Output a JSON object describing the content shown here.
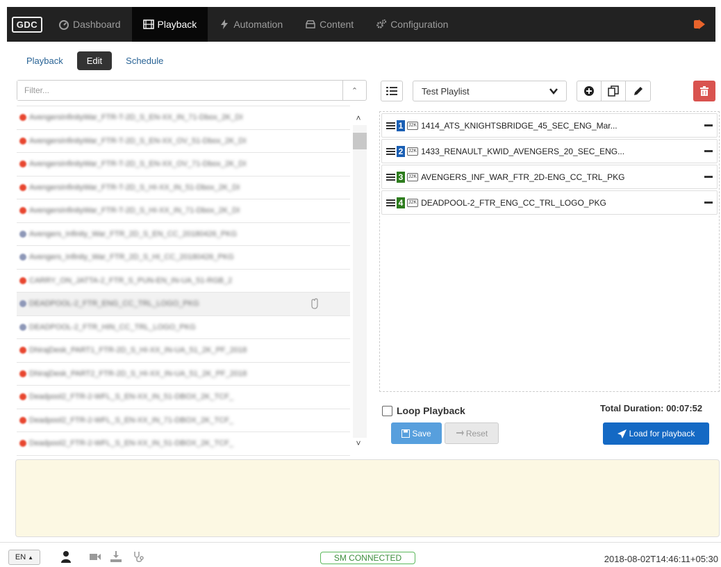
{
  "nav": {
    "logo": "GDC",
    "items": [
      {
        "label": "Dashboard",
        "icon": "dashboard-icon",
        "active": false
      },
      {
        "label": "Playback",
        "icon": "film-icon",
        "active": true
      },
      {
        "label": "Automation",
        "icon": "bolt-icon",
        "active": false
      },
      {
        "label": "Content",
        "icon": "content-icon",
        "active": false
      },
      {
        "label": "Configuration",
        "icon": "gears-icon",
        "active": false
      }
    ],
    "logout_icon": "logout-icon"
  },
  "subnav": {
    "items": [
      {
        "label": "Playback",
        "active": false
      },
      {
        "label": "Edit",
        "active": true
      },
      {
        "label": "Schedule",
        "active": false
      }
    ]
  },
  "filter": {
    "placeholder": "Filter...",
    "value": ""
  },
  "content_list": {
    "rows": [
      {
        "dot": "red",
        "text": "AvengersInfinityWar_FTR-T-2D_S_EN-XX_IN_71-Dbox_2K_DI"
      },
      {
        "dot": "red",
        "text": "AvengersInfinityWar_FTR-T-2D_S_EN-XX_OV_51-Dbox_2K_DI"
      },
      {
        "dot": "red",
        "text": "AvengersInfinityWar_FTR-T-2D_S_EN-XX_OV_71-Dbox_2K_DI"
      },
      {
        "dot": "red",
        "text": "AvengersInfinityWar_FTR-T-2D_S_HI-XX_IN_51-Dbox_2K_DI"
      },
      {
        "dot": "red",
        "text": "AvengersInfinityWar_FTR-T-2D_S_HI-XX_IN_71-Dbox_2K_DI"
      },
      {
        "dot": "blue",
        "text": "Avengers_Infinity_War_FTR_2D_S_EN_CC_20180426_PKG"
      },
      {
        "dot": "blue",
        "text": "Avengers_Infinity_War_FTR_2D_S_HI_CC_20180426_PKG"
      },
      {
        "dot": "red",
        "text": "CARRY_ON_JATTA-2_FTR_S_PUN-EN_IN-UA_51-RGB_2"
      },
      {
        "dot": "blue",
        "text": "DEADPOOL-2_FTR_ENG_CC_TRL_LOGO_PKG"
      },
      {
        "dot": "blue",
        "text": "DEADPOOL-2_FTR_HIN_CC_TRL_LOGO_PKG"
      },
      {
        "dot": "red",
        "text": "DhirajDesk_PART1_FTR-2D_S_HI-XX_IN-UA_51_2K_PF_2018"
      },
      {
        "dot": "red",
        "text": "DhirajDesk_PART2_FTR-2D_S_HI-XX_IN-UA_51_2K_PF_2018"
      },
      {
        "dot": "red",
        "text": "Deadpool2_FTR-2-WFL_S_EN-XX_IN_51-DBOX_2K_TCF_"
      },
      {
        "dot": "red",
        "text": "Deadpool2_FTR-2-WFL_S_EN-XX_IN_71-DBOX_2K_TCF_"
      },
      {
        "dot": "red",
        "text": "Deadpool2_FTR-2-WFL_S_EN-XX_IN_51-DBOX_2K_TCF_"
      }
    ]
  },
  "playlist": {
    "selected": "Test Playlist",
    "items": [
      {
        "number": "1",
        "color": "#1a5fb4",
        "format": "J2K",
        "name": "1414_ATS_KNIGHTSBRIDGE_45_SEC_ENG_Mar..."
      },
      {
        "number": "2",
        "color": "#1a5fb4",
        "format": "J2K",
        "name": "1433_RENAULT_KWID_AVENGERS_20_SEC_ENG..."
      },
      {
        "number": "3",
        "color": "#2e7d1e",
        "format": "J2K",
        "name": "AVENGERS_INF_WAR_FTR_2D-ENG_CC_TRL_PKG"
      },
      {
        "number": "4",
        "color": "#2e7d1e",
        "format": "J2K",
        "name": "DEADPOOL-2_FTR_ENG_CC_TRL_LOGO_PKG"
      }
    ],
    "loop_label": "Loop Playback",
    "loop_checked": false,
    "total_duration": "Total Duration: 00:07:52",
    "save_label": "Save",
    "reset_label": "Reset",
    "load_label": "Load for playback"
  },
  "footer": {
    "language": "EN",
    "status": "SM CONNECTED",
    "timestamp": "2018-08-02T14:46:11+05:30"
  }
}
